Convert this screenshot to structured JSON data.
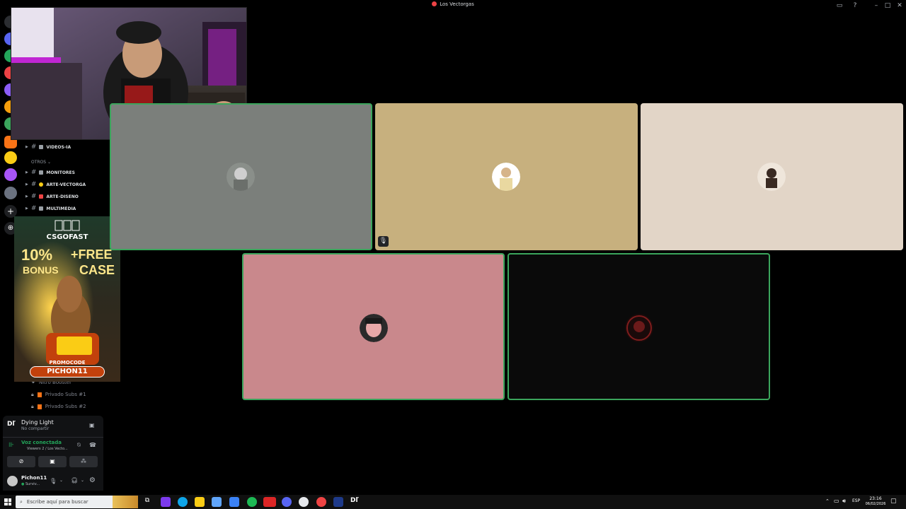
{
  "window": {
    "title": "Los Vectorgas"
  },
  "channels": {
    "items": [
      {
        "label": "VIDEOS-IA"
      },
      {
        "label": "MONITORES"
      },
      {
        "label": "ARTE-VECTORGA"
      },
      {
        "label": "ARTE-DISENO"
      },
      {
        "label": "MULTIMEDIA"
      }
    ],
    "category_otros": "OTROS",
    "locked": [
      {
        "label": "Nitro Booster"
      },
      {
        "label": "Privado Subs #1"
      },
      {
        "label": "Privado Subs #2"
      }
    ]
  },
  "ad": {
    "brand": "CSGOFAST",
    "pct": "10%",
    "bonus": "BONUS",
    "plus_free": "+FREE",
    "case": "CASE",
    "promo_label": "PROMOCODE",
    "promo_code": "PICHON11"
  },
  "activity": {
    "game": "Dying Light",
    "status": "No compartir"
  },
  "voice": {
    "status": "Voz conectada",
    "channel": "Viewers 2 / Los Vecto..."
  },
  "user": {
    "name": "Pichon11",
    "status": "Surviv..."
  },
  "taskbar": {
    "search_placeholder": "Escribe aquí para buscar",
    "lang": "ESP",
    "time": "23:16",
    "date": "06/02/2026"
  },
  "colors": {
    "speaking_border": "#3ba55c",
    "voice_green": "#23a55a"
  }
}
